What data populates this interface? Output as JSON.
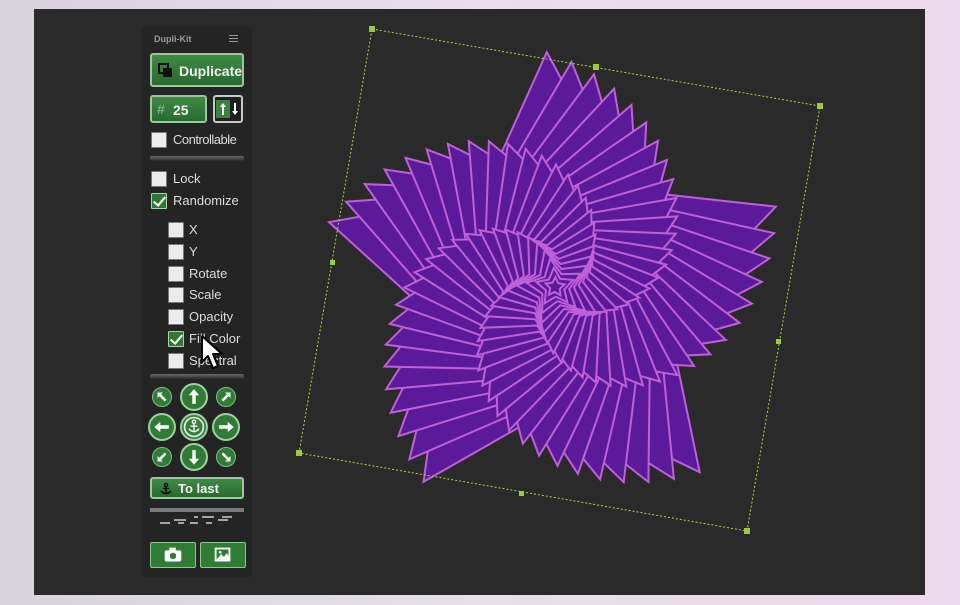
{
  "panel": {
    "title": "Dupli-Kit",
    "menu_icon": "hamburger-menu-icon",
    "duplicate_label": "Duplicate",
    "count_symbol": "#",
    "count_value": "25",
    "order_icon": "up-down-arrows-icon",
    "controllable_label": "Controllable",
    "controllable_checked": false,
    "lock_label": "Lock",
    "lock_checked": false,
    "randomize_label": "Randomize",
    "randomize_checked": true,
    "random_options": [
      {
        "label": "X",
        "checked": false
      },
      {
        "label": "Y",
        "checked": false
      },
      {
        "label": "Rotate",
        "checked": false
      },
      {
        "label": "Scale",
        "checked": false
      },
      {
        "label": "Opacity",
        "checked": false
      },
      {
        "label": "Fill Color",
        "checked": true
      },
      {
        "label": "Spectral",
        "checked": false
      }
    ],
    "direction_pad": [
      "up-left-arrow-icon",
      "up-arrow-icon",
      "up-right-arrow-icon",
      "left-arrow-icon",
      "anchor-icon",
      "right-arrow-icon",
      "down-left-arrow-icon",
      "down-arrow-icon",
      "down-right-arrow-icon"
    ],
    "to_last_label": "To last",
    "footer_icons": [
      "camera-icon",
      "image-icon"
    ]
  },
  "colors": {
    "accent_green": "#2f7c35",
    "shape_fill": "#5a1a9a",
    "shape_stroke": "#c060d8",
    "selection": "#9acd32"
  }
}
